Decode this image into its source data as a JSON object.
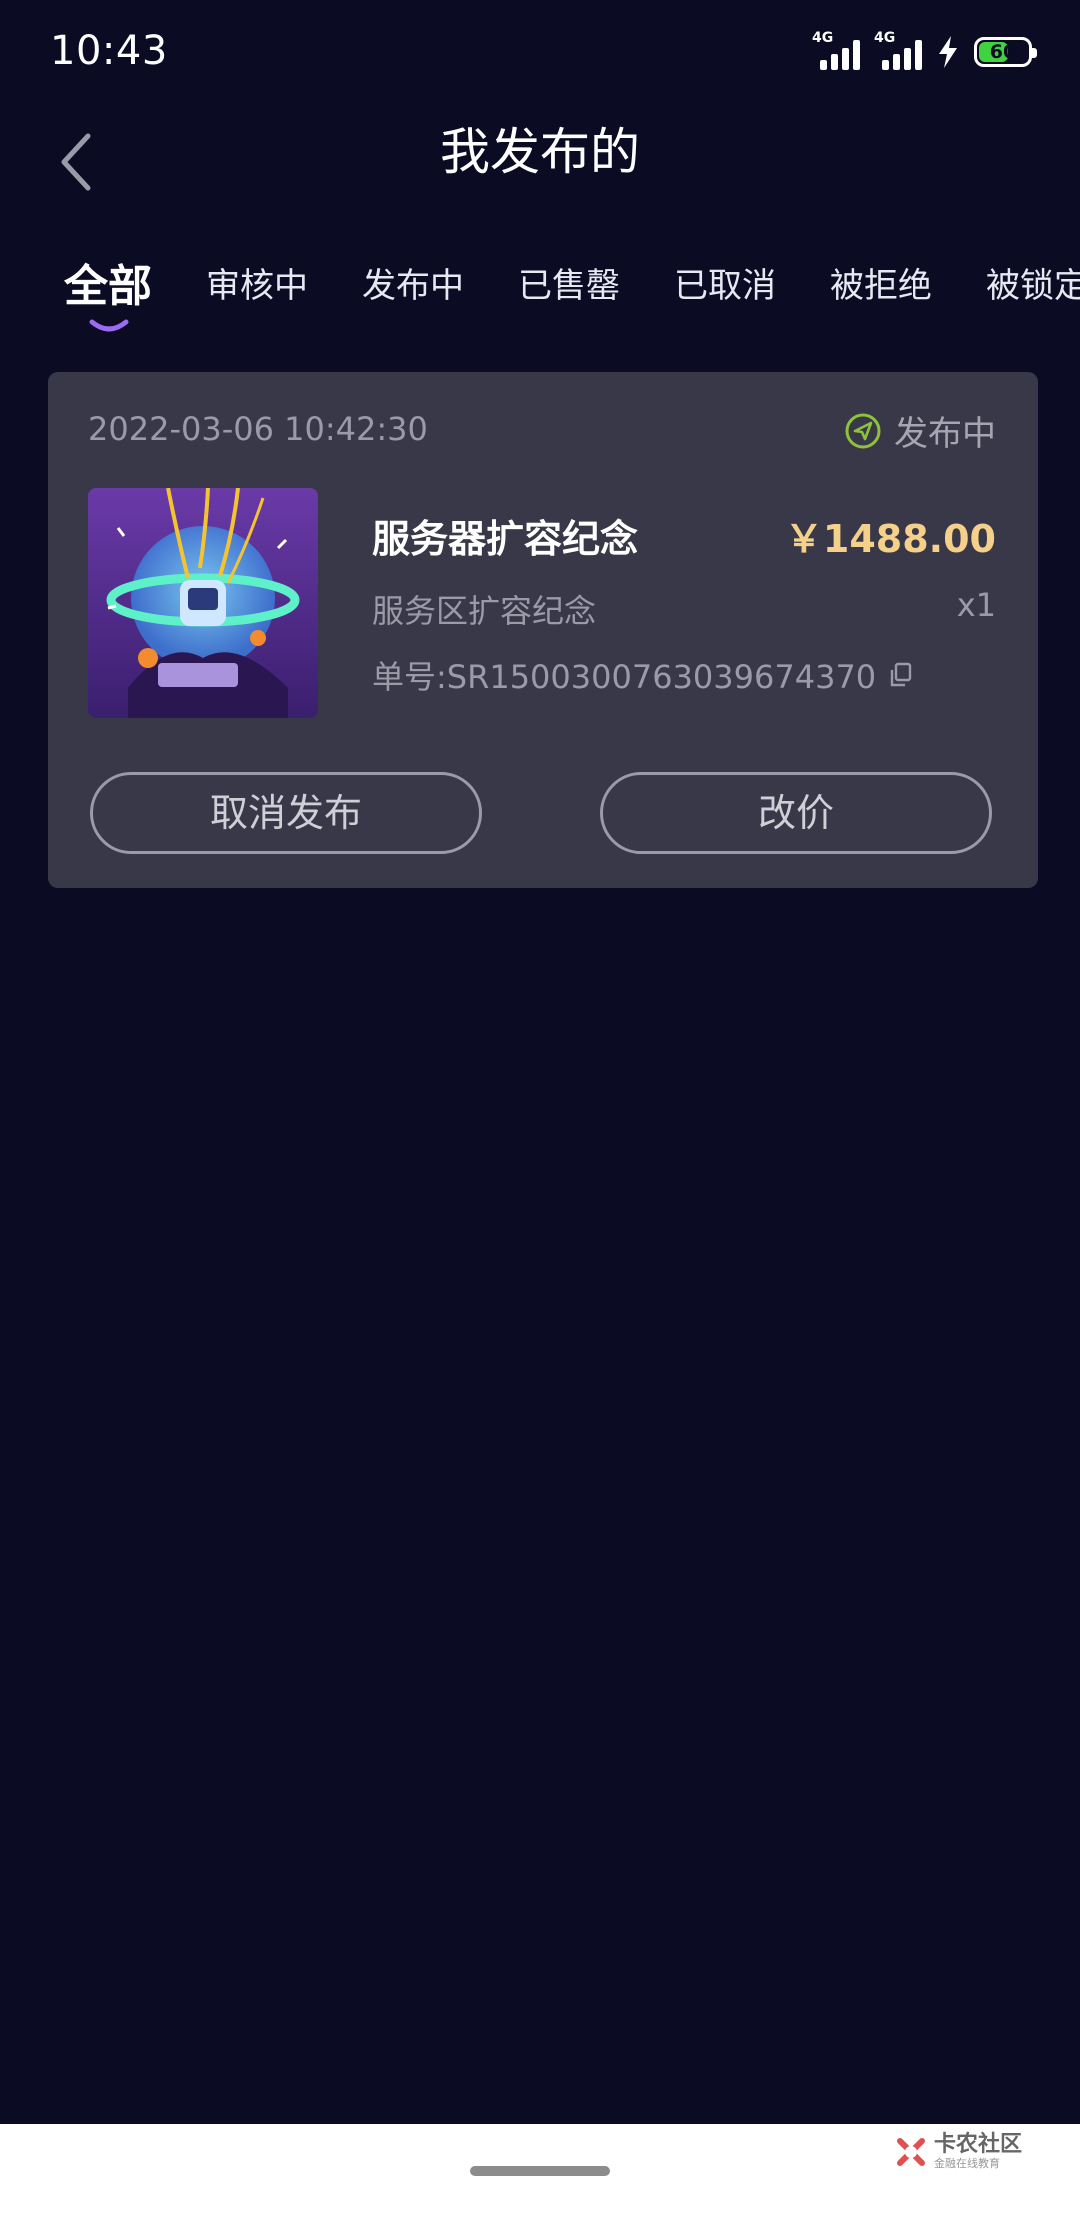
{
  "status_bar": {
    "time": "10:43",
    "network_1": "4G",
    "network_2": "4G",
    "battery_level": "60",
    "battery_fraction": 0.6
  },
  "header": {
    "title": "我发布的"
  },
  "tabs": [
    {
      "label": "全部",
      "active": true
    },
    {
      "label": "审核中"
    },
    {
      "label": "发布中"
    },
    {
      "label": "已售罄"
    },
    {
      "label": "已取消"
    },
    {
      "label": "被拒绝"
    },
    {
      "label": "被锁定"
    }
  ],
  "order": {
    "time": "2022-03-06 10:42:30",
    "status": "发布中",
    "product_name": "服务器扩容纪念",
    "price": "￥1488.00",
    "subtitle": "服务区扩容纪念",
    "quantity": "x1",
    "order_no": "单号:SR1500300763039674370",
    "cancel_label": "取消发布",
    "change_price_label": "改价"
  },
  "colors": {
    "background": "#0b0b24",
    "card": "#383848",
    "price": "#f4d08a",
    "status_icon": "#8fc23c",
    "tab_indicator": "#9b6cf2"
  },
  "watermark": {
    "main": "卡农社区",
    "sub": "金融在线教育"
  }
}
